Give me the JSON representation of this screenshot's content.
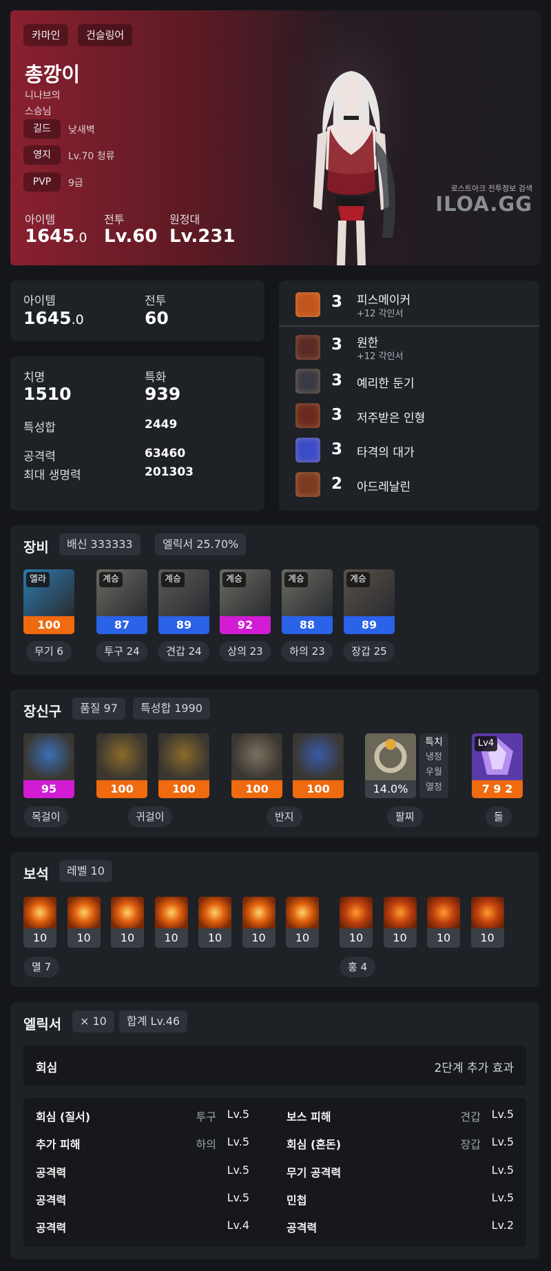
{
  "hero": {
    "tags": [
      "카마인",
      "건슬링어"
    ],
    "name": "총깡이",
    "title_line1": "니나브의",
    "title_line2": "스승님",
    "guild_label": "길드",
    "guild_value": "낮새벽",
    "estate_label": "영지",
    "estate_value": "Lv.70 청류",
    "pvp_label": "PVP",
    "pvp_value": "9급",
    "item_label": "아이템",
    "item_main": "1645",
    "item_dec": ".0",
    "battle_label": "전투",
    "battle_value": "Lv.60",
    "expedition_label": "원정대",
    "expedition_value": "Lv.231",
    "brand_caption": "로스트아크 전투정보 검색",
    "brand_logo": "ILOA.GG"
  },
  "levels": {
    "item_label": "아이템",
    "item_main": "1645",
    "item_dec": ".0",
    "battle_label": "전투",
    "battle_value": "60"
  },
  "stats": {
    "crit_label": "치명",
    "crit_value": "1510",
    "spec_label": "특화",
    "spec_value": "939",
    "total_label": "특성합",
    "total_value": "2449",
    "atk_label": "공격력",
    "atk_value": "63460",
    "hp_label": "최대 생명력",
    "hp_value": "201303"
  },
  "engravings": [
    {
      "level": "3",
      "name": "피스메이커",
      "sub": "+12 각인서",
      "icon": "peacemaker-icon",
      "color": "#c2541d"
    },
    {
      "level": "3",
      "name": "원한",
      "sub": "+12 각인서",
      "icon": "grudge-icon",
      "color": "#5a2a26"
    },
    {
      "level": "3",
      "name": "예리한 둔기",
      "sub": "",
      "icon": "keen-blunt-icon",
      "color": "#3a3a44"
    },
    {
      "level": "3",
      "name": "저주받은 인형",
      "sub": "",
      "icon": "cursed-doll-icon",
      "color": "#6a2a20"
    },
    {
      "level": "3",
      "name": "타격의 대가",
      "sub": "",
      "icon": "hit-master-icon",
      "color": "#3a4cc8"
    },
    {
      "level": "2",
      "name": "아드레날린",
      "sub": "",
      "icon": "adrenaline-icon",
      "color": "#7a3a22"
    }
  ],
  "equipment": {
    "title": "장비",
    "chip1": "배신 333333",
    "chip2": "엘릭서 25.70%",
    "items": [
      {
        "badge": "엘라",
        "quality": "100",
        "qcolor": "#f06a0f",
        "label": "무기 6",
        "icon": "weapon-icon"
      },
      {
        "badge": "계승",
        "quality": "87",
        "qcolor": "#2a62e8",
        "label": "투구 24",
        "icon": "helmet-icon"
      },
      {
        "badge": "계승",
        "quality": "89",
        "qcolor": "#2a62e8",
        "label": "견갑 24",
        "icon": "shoulder-icon"
      },
      {
        "badge": "계승",
        "quality": "92",
        "qcolor": "#d21cd4",
        "label": "상의 23",
        "icon": "chest-icon"
      },
      {
        "badge": "계승",
        "quality": "88",
        "qcolor": "#2a62e8",
        "label": "하의 23",
        "icon": "pants-icon"
      },
      {
        "badge": "계승",
        "quality": "89",
        "qcolor": "#2a62e8",
        "label": "장갑 25",
        "icon": "gloves-icon"
      }
    ]
  },
  "accessories": {
    "title": "장신구",
    "chip1": "품질 97",
    "chip2": "특성합 1990",
    "items": [
      {
        "quality": "95",
        "qcolor": "#d21cd4",
        "icon": "necklace-icon"
      },
      {
        "quality": "100",
        "qcolor": "#f06a0f",
        "icon": "earring-icon"
      },
      {
        "quality": "100",
        "qcolor": "#f06a0f",
        "icon": "earring-icon"
      },
      {
        "quality": "100",
        "qcolor": "#f06a0f",
        "icon": "ring-icon"
      },
      {
        "quality": "100",
        "qcolor": "#f06a0f",
        "icon": "ring-icon"
      }
    ],
    "bracelet_value": "14.0%",
    "bracelet_effects": [
      "특치",
      "냉정",
      "우월",
      "열정"
    ],
    "stone_badge": "Lv4",
    "stone_value": "7 9 2",
    "labels": {
      "necklace": "목걸이",
      "earring": "귀걸이",
      "ring": "반지",
      "bracelet": "팔찌",
      "stone": "돌"
    }
  },
  "gems": {
    "title": "보석",
    "chip": "레벨 10",
    "doom_levels": [
      "10",
      "10",
      "10",
      "10",
      "10",
      "10",
      "10"
    ],
    "cool_levels": [
      "10",
      "10",
      "10",
      "10"
    ],
    "doom_label": "멸 7",
    "cool_label": "홍 4"
  },
  "elixir": {
    "title": "엘릭서",
    "chip1": "× 10",
    "chip2": "합계 Lv.46",
    "set_name": "회심",
    "set_effect": "2단계 추가 효과",
    "left": [
      {
        "name": "회심 (질서)",
        "slot": "투구",
        "lv": "Lv.5"
      },
      {
        "name": "추가 피해",
        "slot": "하의",
        "lv": "Lv.5"
      },
      {
        "name": "공격력",
        "slot": "",
        "lv": "Lv.5"
      },
      {
        "name": "공격력",
        "slot": "",
        "lv": "Lv.5"
      },
      {
        "name": "공격력",
        "slot": "",
        "lv": "Lv.4"
      }
    ],
    "right": [
      {
        "name": "보스 피해",
        "slot": "견갑",
        "lv": "Lv.5"
      },
      {
        "name": "회심 (혼돈)",
        "slot": "장갑",
        "lv": "Lv.5"
      },
      {
        "name": "무기 공격력",
        "slot": "",
        "lv": "Lv.5"
      },
      {
        "name": "민첩",
        "slot": "",
        "lv": "Lv.5"
      },
      {
        "name": "공격력",
        "slot": "",
        "lv": "Lv.2"
      }
    ]
  }
}
